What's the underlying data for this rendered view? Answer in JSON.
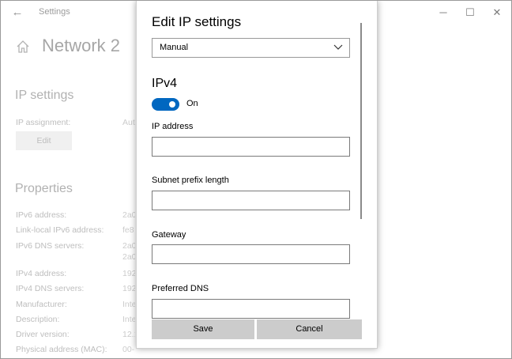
{
  "window": {
    "app_title": "Settings",
    "back_icon": "back-arrow-icon",
    "controls": {
      "minimize": "─",
      "maximize": "☐",
      "close": "✕"
    }
  },
  "background": {
    "page_title": "Network 2",
    "ip_settings": {
      "heading": "IP settings",
      "assignment_label": "IP assignment:",
      "assignment_value": "Automatic (DHCP)",
      "edit_button": "Edit"
    },
    "properties": {
      "heading": "Properties",
      "rows": [
        {
          "label": "IPv6 address:",
          "value": "2a0"
        },
        {
          "label": "Link-local IPv6 address:",
          "value": "fe8"
        },
        {
          "label": "IPv6 DNS servers:",
          "value": "2a0"
        },
        {
          "label": "",
          "value": "2a0"
        },
        {
          "label": "IPv4 address:",
          "value": "192"
        },
        {
          "label": "IPv4 DNS servers:",
          "value": "192"
        },
        {
          "label": "Manufacturer:",
          "value": "Inte"
        },
        {
          "label": "Description:",
          "value": "Inte"
        },
        {
          "label": "Driver version:",
          "value": "12.1"
        },
        {
          "label": "Physical address (MAC):",
          "value": "00-"
        }
      ]
    }
  },
  "dialog": {
    "title": "Edit IP settings",
    "mode_select": {
      "value": "Manual"
    },
    "ipv4": {
      "heading": "IPv4",
      "toggle_state": "On",
      "fields": [
        {
          "label": "IP address",
          "value": ""
        },
        {
          "label": "Subnet prefix length",
          "value": ""
        },
        {
          "label": "Gateway",
          "value": ""
        },
        {
          "label": "Preferred DNS",
          "value": ""
        }
      ]
    },
    "buttons": {
      "save": "Save",
      "cancel": "Cancel"
    }
  },
  "colors": {
    "accent": "#0067c0",
    "button_bg": "#cccccc"
  }
}
